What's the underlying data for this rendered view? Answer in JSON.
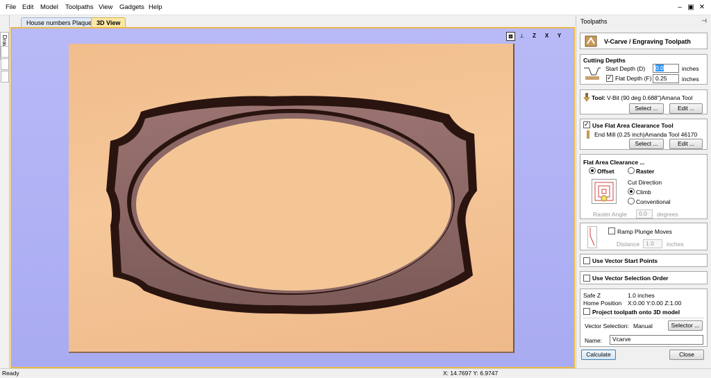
{
  "menu": [
    "File",
    "Edit",
    "Model",
    "Toolpaths",
    "View",
    "Gadgets",
    "Help"
  ],
  "window_controls": [
    "–",
    "▣",
    "✕"
  ],
  "left_strip": {
    "tab_label": "Drawing"
  },
  "tabs": [
    {
      "label": "House numbers Plaque",
      "active": false
    },
    {
      "label": "3D View",
      "active": true
    }
  ],
  "view_icons": [
    "iso-view-icon",
    "view-x-icon",
    "view-z-icon",
    "view-y-icon"
  ],
  "view_icon_glyphs": [
    "⊠",
    "⟂",
    "Z",
    "X",
    "Y"
  ],
  "colors": {
    "board": "#f5c799",
    "viewport": "#b0b2f5",
    "carve": "#8c6a67",
    "carve_dark": "#2e1511"
  },
  "toolpaths_panel": {
    "title": "Toolpaths",
    "pin": "⊣",
    "heading": "V-Carve / Engraving Toolpath",
    "cutting_depths": {
      "title": "Cutting Depths",
      "start_depth_label": "Start Depth (D)",
      "start_depth_value": "0.0",
      "flat_depth_label": "Flat Depth (F)",
      "flat_depth_value": "0.25",
      "flat_depth_checked": true,
      "unit": "inches"
    },
    "tool": {
      "label": "Tool:",
      "name": "V-Bit (90 deg 0.688\")Amana Tool",
      "select_label": "Select ...",
      "edit_label": "Edit ..."
    },
    "flat_area_tool": {
      "label": "Use Flat Area Clearance Tool",
      "checked": true,
      "name": "End Mill (0.25 inch)Amanda Tool 46170",
      "select_label": "Select ...",
      "edit_label": "Edit ..."
    },
    "flat_area_clearance": {
      "title": "Flat Area Clearance ...",
      "offset_label": "Offset",
      "raster_label": "Raster",
      "strategy": "Offset",
      "cut_direction_label": "Cut Direction",
      "climb_label": "Climb",
      "conventional_label": "Conventional",
      "direction": "Climb",
      "raster_angle_label": "Raster Angle",
      "raster_angle_value": "0.0",
      "raster_angle_unit": "degrees"
    },
    "ramp": {
      "label": "Ramp Plunge Moves",
      "checked": false,
      "distance_label": "Distance",
      "distance_value": "1.0",
      "distance_unit": "inches"
    },
    "vector_start_points": {
      "label": "Use Vector Start Points",
      "checked": false
    },
    "vector_selection_order": {
      "label": "Use Vector Selection Order",
      "checked": false
    },
    "settings": {
      "safe_z_label": "Safe Z",
      "safe_z_value": "1.0 inches",
      "home_label": "Home Position",
      "home_value": "X:0.00 Y:0.00 Z:1.00",
      "project_label": "Project toolpath onto 3D model",
      "project_checked": false,
      "vector_selection_label": "Vector Selection:",
      "vector_selection_value": "Manual",
      "selector_label": "Selector ...",
      "name_label": "Name:",
      "name_value": "Vcarve"
    },
    "calculate_label": "Calculate",
    "close_label": "Close"
  },
  "status": {
    "left": "Ready",
    "coords": "X: 14.7697 Y:  6.9747"
  }
}
